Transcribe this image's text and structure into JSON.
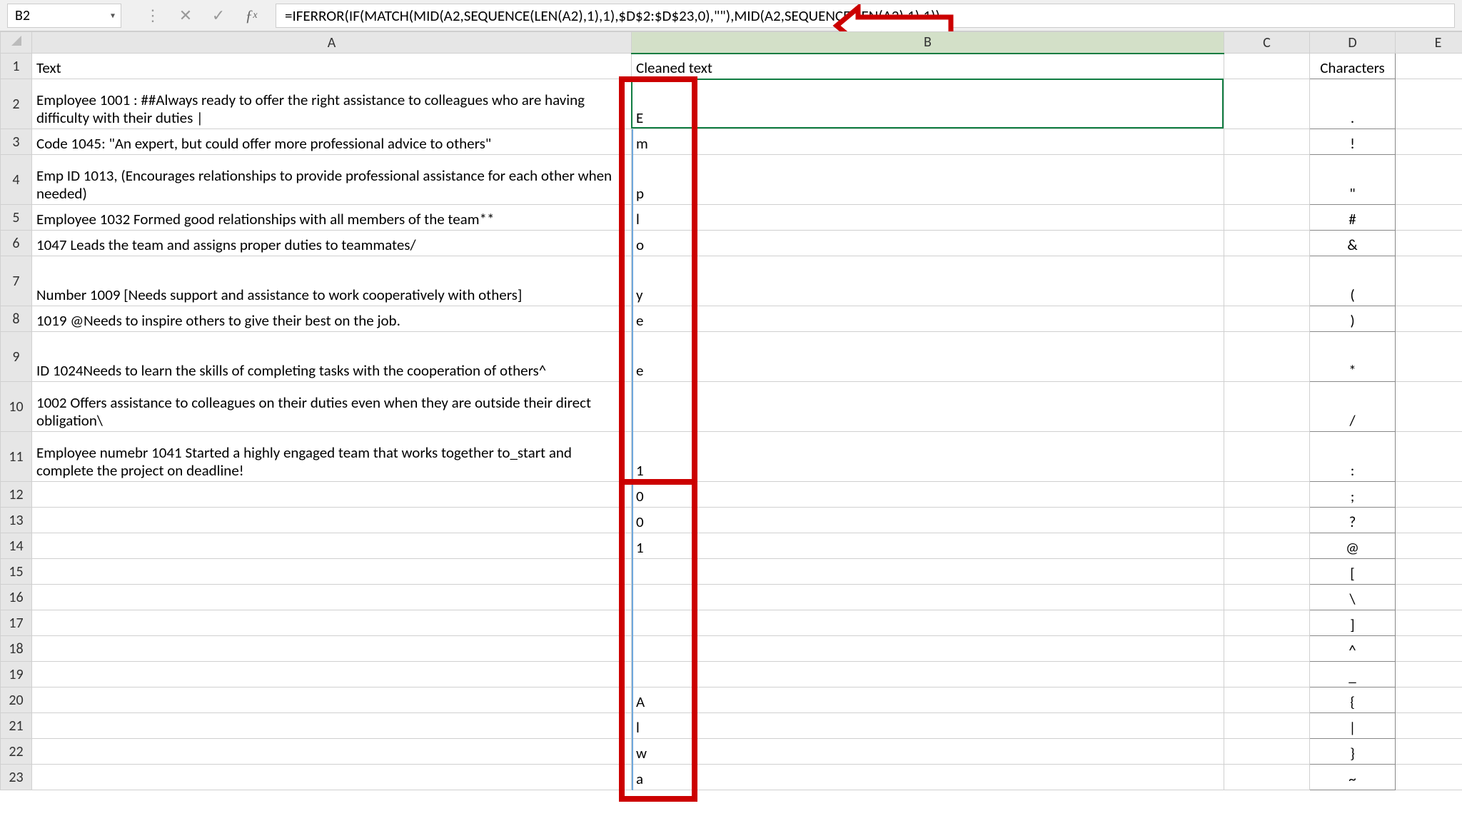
{
  "name_box": "B2",
  "formula": "=IFERROR(IF(MATCH(MID(A2,SEQUENCE(LEN(A2),1),1),$D$2:$D$23,0),\"\"),MID(A2,SEQUENCE(LEN(A2),1),1))",
  "columns": {
    "A": "A",
    "B": "B",
    "C": "C",
    "D": "D",
    "E": "E"
  },
  "headers": {
    "A": "Text",
    "B": "Cleaned text",
    "D": "Characters"
  },
  "colA": {
    "r2": "Employee 1001 : ##Always ready to offer the right assistance to colleagues who are having difficulty with their duties |",
    "r3": "Code 1045: \"An expert, but could offer more professional advice to others\"",
    "r4": "Emp ID 1013, (Encourages relationships to provide professional assistance for each other when needed)",
    "r5": "Employee 1032 Formed good relationships with all members of the team**",
    "r6": "1047 Leads the team and assigns proper duties to teammates/",
    "r7": "Number 1009 [Needs support and assistance to work cooperatively with others]",
    "r8": "1019 @Needs to inspire others to give their best on the job.",
    "r9": "ID 1024Needs to learn the skills of completing tasks with the cooperation of others^",
    "r10": "1002 Offers assistance to colleagues on their duties even when they are outside their direct obligation\\",
    "r11": "Employee numebr 1041 Started a highly engaged team that works together to_start and complete the project on deadline!"
  },
  "colB": {
    "r2": "E",
    "r3": "m",
    "r4": "p",
    "r5": "l",
    "r6": "o",
    "r7": "y",
    "r8": "e",
    "r9": "e",
    "r10": "",
    "r11": "1",
    "r12": "0",
    "r13": "0",
    "r14": "1",
    "r15": "",
    "r16": "",
    "r17": "",
    "r18": "",
    "r19": "",
    "r20": "A",
    "r21": "l",
    "r22": "w",
    "r23": "a"
  },
  "colD": {
    "r2": ".",
    "r3": "!",
    "r4": "\"",
    "r5": "#",
    "r6": "&",
    "r7": "(",
    "r8": ")",
    "r9": "*",
    "r10": "/",
    "r11": ":",
    "r12": ";",
    "r13": "?",
    "r14": "@",
    "r15": "[",
    "r16": "\\",
    "r17": "]",
    "r18": "^",
    "r19": "_",
    "r20": "{",
    "r21": "|",
    "r22": "}",
    "r23": "~"
  },
  "rows": [
    "1",
    "2",
    "3",
    "4",
    "5",
    "6",
    "7",
    "8",
    "9",
    "10",
    "11",
    "12",
    "13",
    "14",
    "15",
    "16",
    "17",
    "18",
    "19",
    "20",
    "21",
    "22",
    "23"
  ],
  "icons": {
    "dots": "⋮",
    "cancel": "✕",
    "enter": "✓",
    "caret": "▾"
  }
}
